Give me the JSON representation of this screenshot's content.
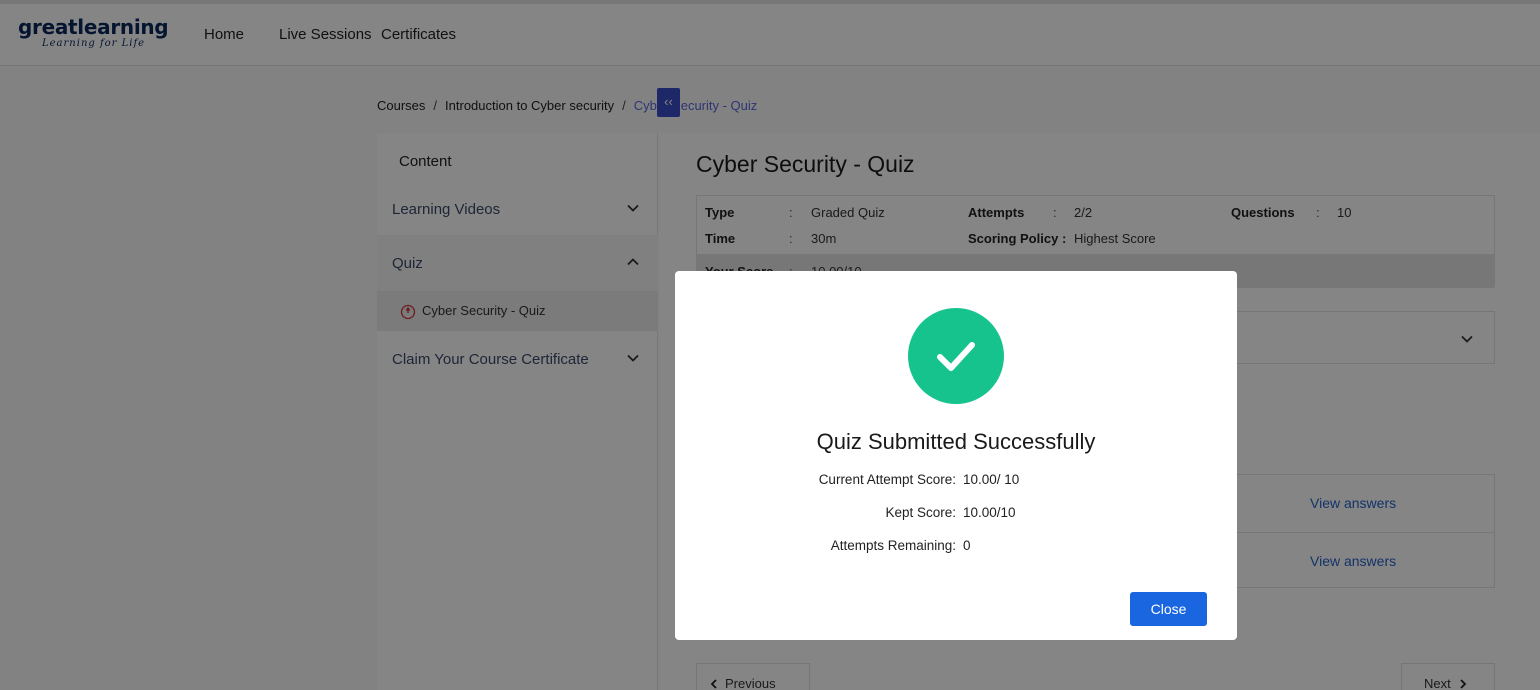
{
  "header": {
    "logo": {
      "text": "greatlearning",
      "tagline": "Learning for Life"
    },
    "nav": [
      "Home",
      "Live Sessions",
      "Certificates"
    ]
  },
  "breadcrumb": [
    "Courses",
    "Introduction to Cyber security",
    "Cyber Security - Quiz"
  ],
  "breadcrumb_separator": "/",
  "sidebar": {
    "heading": "Content",
    "collapse_glyph": "‹‹",
    "sections": [
      {
        "label": "Learning Videos",
        "expanded": false
      },
      {
        "label": "Quiz",
        "expanded": true,
        "items": [
          {
            "label": "Cyber Security - Quiz",
            "icon": "quiz-status-icon"
          }
        ]
      },
      {
        "label": "Claim Your Course Certificate",
        "expanded": false
      }
    ]
  },
  "quiz": {
    "title": "Cyber Security - Quiz",
    "info": {
      "type_label": "Type",
      "type_value": "Graded Quiz",
      "attempts_label": "Attempts",
      "attempts_value": "2/2",
      "questions_label": "Questions",
      "questions_value": "10",
      "time_label": "Time",
      "time_value": "30m",
      "scoring_label": "Scoring Policy",
      "scoring_value": "Highest Score",
      "score_label": "Your Score",
      "score_value": "10.00/10",
      "colon": ":"
    },
    "attempt_rows": [
      {
        "action": "View answers"
      },
      {
        "action": "View answers"
      }
    ],
    "prev_label": "Previous",
    "next_label": "Next"
  },
  "modal": {
    "title": "Quiz Submitted Successfully",
    "rows": [
      {
        "label": "Current Attempt Score:",
        "value": "10.00/ 10"
      },
      {
        "label": "Kept Score:",
        "value": "10.00/10"
      },
      {
        "label": "Attempts Remaining:",
        "value": "0"
      }
    ],
    "close_label": "Close"
  },
  "colors": {
    "accent": "#3b4bc8",
    "success": "#17c38d",
    "primary_button": "#1a66e0",
    "link": "#2563c9",
    "breadcrumb_current": "#5a67d8"
  }
}
